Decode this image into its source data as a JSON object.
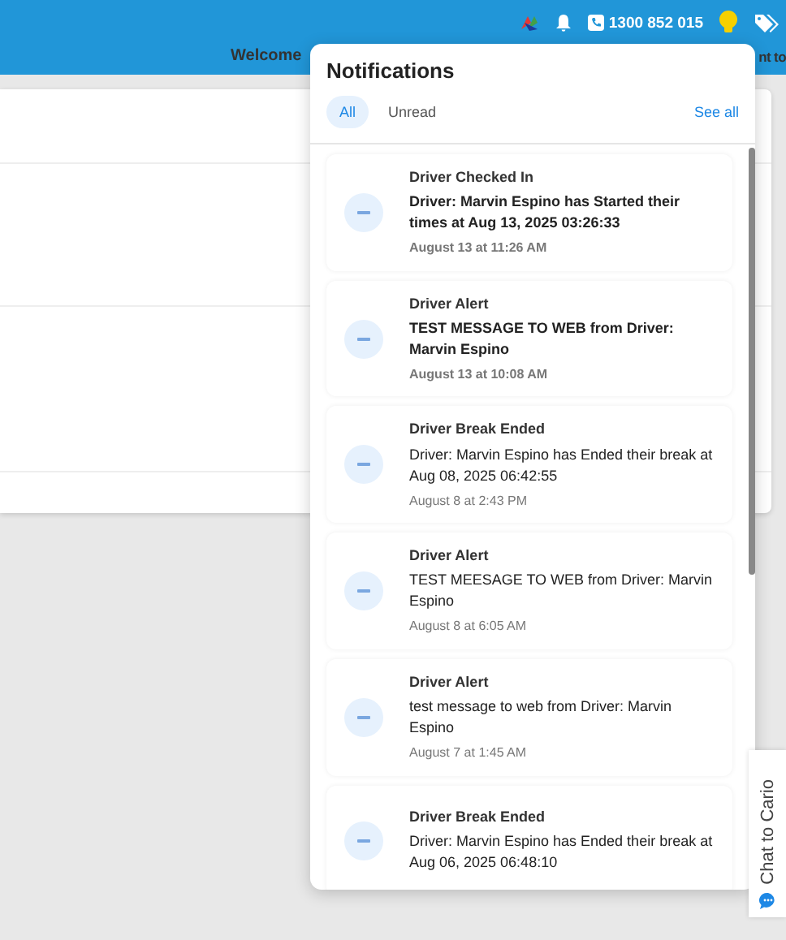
{
  "header": {
    "welcome_left": "Welcome",
    "welcome_right": "nt to",
    "phone": "1300 852 015"
  },
  "notifications": {
    "title": "Notifications",
    "tabs": [
      {
        "label": "All",
        "selected": true
      },
      {
        "label": "Unread",
        "selected": false
      }
    ],
    "see_all": "See all",
    "items": [
      {
        "title": "Driver Checked In",
        "message": "Driver: Marvin Espino has Started their times at Aug 13, 2025 03:26:33",
        "time": "August 13 at 11:26 AM",
        "unread": true
      },
      {
        "title": "Driver Alert",
        "message": "TEST MESSAGE TO WEB from Driver: Marvin Espino",
        "time": "August 13 at 10:08 AM",
        "unread": true
      },
      {
        "title": "Driver Break Ended",
        "message": "Driver: Marvin Espino has Ended their break at Aug 08, 2025 06:42:55",
        "time": "August 8 at 2:43 PM",
        "unread": false
      },
      {
        "title": "Driver Alert",
        "message": "TEST MEESAGE TO WEB from Driver: Marvin Espino",
        "time": "August 8 at 6:05 AM",
        "unread": false
      },
      {
        "title": "Driver Alert",
        "message": "test message to web from Driver: Marvin Espino",
        "time": "August 7 at 1:45 AM",
        "unread": false
      },
      {
        "title": "Driver Break Ended",
        "message": "Driver: Marvin Espino has Ended their break at Aug 06, 2025 06:48:10",
        "unread": false
      }
    ]
  },
  "chat_tab": {
    "label": "Chat to Cario"
  }
}
